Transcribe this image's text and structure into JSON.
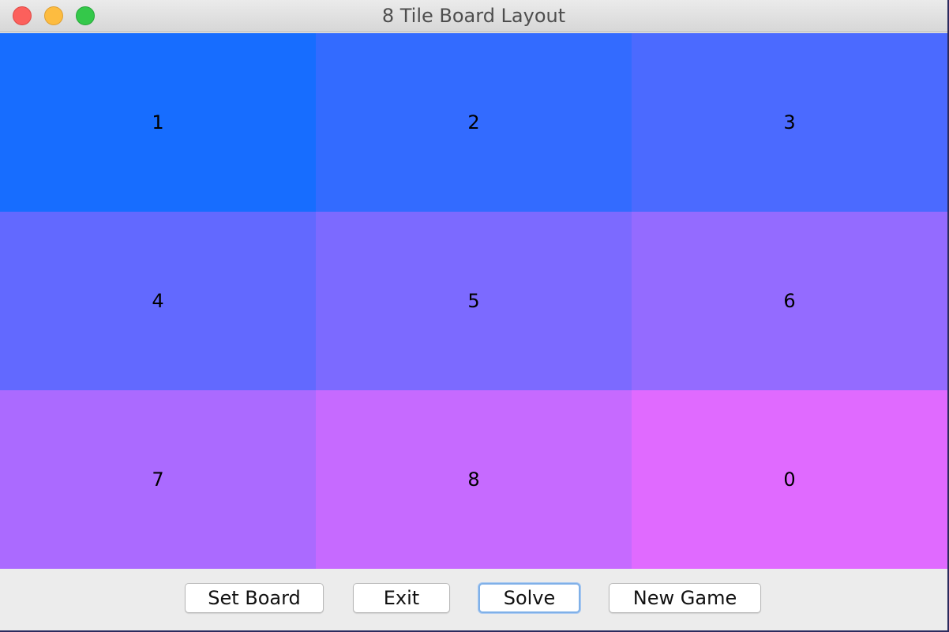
{
  "window": {
    "title": "8 Tile Board Layout"
  },
  "board": {
    "tiles": [
      {
        "label": "1",
        "color": "#176dff"
      },
      {
        "label": "2",
        "color": "#336bff"
      },
      {
        "label": "3",
        "color": "#4b6aff"
      },
      {
        "label": "4",
        "color": "#6269ff"
      },
      {
        "label": "5",
        "color": "#7c6aff"
      },
      {
        "label": "6",
        "color": "#946bff"
      },
      {
        "label": "7",
        "color": "#ab6aff"
      },
      {
        "label": "8",
        "color": "#c66aff"
      },
      {
        "label": "0",
        "color": "#e06aff"
      }
    ]
  },
  "controls": {
    "set_board_label": "Set Board",
    "exit_label": "Exit",
    "solve_label": "Solve",
    "new_game_label": "New Game"
  }
}
